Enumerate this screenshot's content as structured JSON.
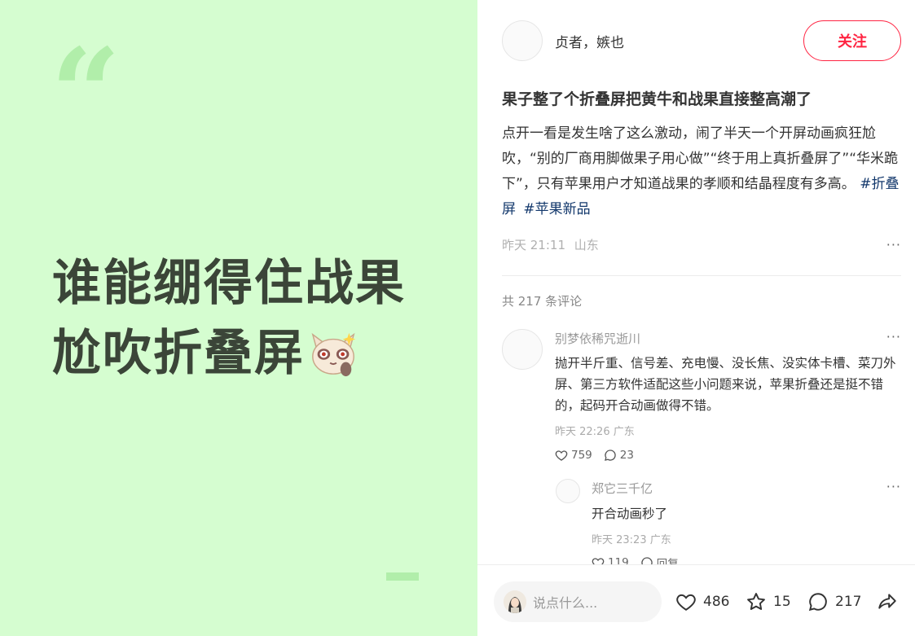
{
  "cover": {
    "line1": "谁能绷得住战果",
    "line2": "尬吹折叠屏"
  },
  "author": {
    "name": "贞者，嫉也",
    "follow_label": "关注"
  },
  "post": {
    "title": "果子整了个折叠屏把黄牛和战果直接整高潮了",
    "description": "点开一看是发生啥了这么激动，闹了半天一个开屏动画疯狂尬吹，“别的厂商用脚做果子用心做”“终于用上真折叠屏了”“华米跪下”，只有苹果用户才知道战果的孝顺和结晶程度有多高。",
    "tags": [
      "#折叠屏",
      "#苹果新品"
    ],
    "date": "昨天 21:11",
    "location": "山东",
    "more": "···"
  },
  "comments": {
    "total_label": "共 217 条评论",
    "items": [
      {
        "author": "别梦依稀咒逝川",
        "text": "抛开半斤重、信号差、充电慢、没长焦、没实体卡槽、菜刀外屏、第三方软件适配这些小问题来说，苹果折叠还是挺不错的，起码开合动画做得不错。",
        "time": "昨天 22:26 广东",
        "likes": "759",
        "replies": "23",
        "more": "···"
      }
    ],
    "reply": {
      "author": "郑它三千亿",
      "text": "开合动画秒了",
      "time": "昨天 23:23 广东",
      "likes": "119",
      "reply_label": "回复",
      "more": "···"
    }
  },
  "bottom_bar": {
    "placeholder": "说点什么...",
    "likes": "486",
    "stars": "15",
    "comments": "217"
  },
  "colors": {
    "cover_bg": "#d5fdd0",
    "cover_accent": "#b1eeaa",
    "follow_red": "#ff2442",
    "tag_blue": "#13386c"
  }
}
